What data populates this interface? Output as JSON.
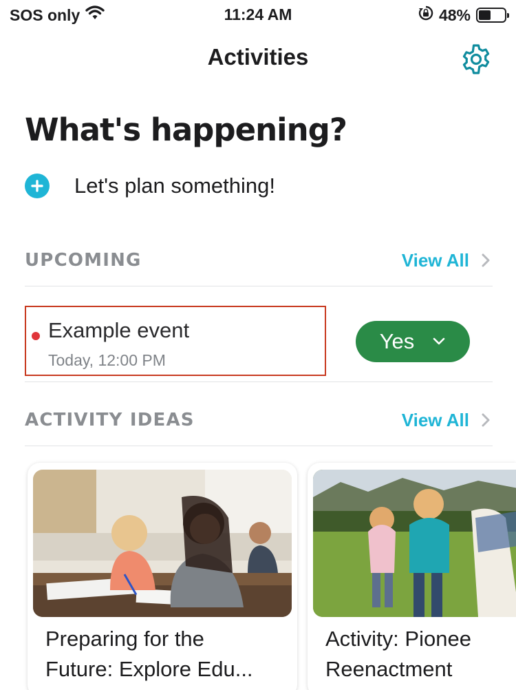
{
  "status_bar": {
    "carrier": "SOS only",
    "time": "11:24 AM",
    "battery": "48%",
    "battery_level": 0.48
  },
  "nav": {
    "title": "Activities",
    "settings_icon": "gear-icon"
  },
  "heading": "What's happening?",
  "plan": {
    "label": "Let's plan something!",
    "icon": "plus-circle-icon"
  },
  "upcoming": {
    "section_title": "UPCOMING",
    "view_all": "View All",
    "events": [
      {
        "title": "Example event",
        "time": "Today, 12:00 PM",
        "rsvp": "Yes"
      }
    ]
  },
  "ideas": {
    "section_title": "ACTIVITY IDEAS",
    "view_all": "View All",
    "cards": [
      {
        "title": "Preparing for the\nFuture: Explore Edu..."
      },
      {
        "title": "Activity: Pionee\nReenactment"
      }
    ]
  },
  "colors": {
    "accent": "#1fb5d6",
    "rsvp_green": "#2a8b47",
    "event_dot": "#e0353a",
    "highlight_border": "#c8391f"
  }
}
